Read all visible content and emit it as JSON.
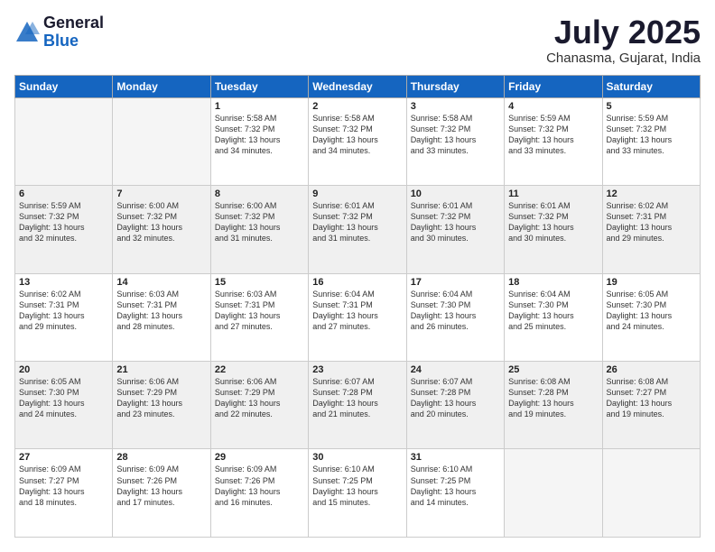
{
  "logo": {
    "general": "General",
    "blue": "Blue"
  },
  "title": "July 2025",
  "location": "Chanasma, Gujarat, India",
  "days_header": [
    "Sunday",
    "Monday",
    "Tuesday",
    "Wednesday",
    "Thursday",
    "Friday",
    "Saturday"
  ],
  "weeks": [
    [
      {
        "day": "",
        "sunrise": "",
        "sunset": "",
        "daylight": ""
      },
      {
        "day": "",
        "sunrise": "",
        "sunset": "",
        "daylight": ""
      },
      {
        "day": "1",
        "sunrise": "Sunrise: 5:58 AM",
        "sunset": "Sunset: 7:32 PM",
        "daylight": "Daylight: 13 hours and 34 minutes."
      },
      {
        "day": "2",
        "sunrise": "Sunrise: 5:58 AM",
        "sunset": "Sunset: 7:32 PM",
        "daylight": "Daylight: 13 hours and 34 minutes."
      },
      {
        "day": "3",
        "sunrise": "Sunrise: 5:58 AM",
        "sunset": "Sunset: 7:32 PM",
        "daylight": "Daylight: 13 hours and 33 minutes."
      },
      {
        "day": "4",
        "sunrise": "Sunrise: 5:59 AM",
        "sunset": "Sunset: 7:32 PM",
        "daylight": "Daylight: 13 hours and 33 minutes."
      },
      {
        "day": "5",
        "sunrise": "Sunrise: 5:59 AM",
        "sunset": "Sunset: 7:32 PM",
        "daylight": "Daylight: 13 hours and 33 minutes."
      }
    ],
    [
      {
        "day": "6",
        "sunrise": "Sunrise: 5:59 AM",
        "sunset": "Sunset: 7:32 PM",
        "daylight": "Daylight: 13 hours and 32 minutes."
      },
      {
        "day": "7",
        "sunrise": "Sunrise: 6:00 AM",
        "sunset": "Sunset: 7:32 PM",
        "daylight": "Daylight: 13 hours and 32 minutes."
      },
      {
        "day": "8",
        "sunrise": "Sunrise: 6:00 AM",
        "sunset": "Sunset: 7:32 PM",
        "daylight": "Daylight: 13 hours and 31 minutes."
      },
      {
        "day": "9",
        "sunrise": "Sunrise: 6:01 AM",
        "sunset": "Sunset: 7:32 PM",
        "daylight": "Daylight: 13 hours and 31 minutes."
      },
      {
        "day": "10",
        "sunrise": "Sunrise: 6:01 AM",
        "sunset": "Sunset: 7:32 PM",
        "daylight": "Daylight: 13 hours and 30 minutes."
      },
      {
        "day": "11",
        "sunrise": "Sunrise: 6:01 AM",
        "sunset": "Sunset: 7:32 PM",
        "daylight": "Daylight: 13 hours and 30 minutes."
      },
      {
        "day": "12",
        "sunrise": "Sunrise: 6:02 AM",
        "sunset": "Sunset: 7:31 PM",
        "daylight": "Daylight: 13 hours and 29 minutes."
      }
    ],
    [
      {
        "day": "13",
        "sunrise": "Sunrise: 6:02 AM",
        "sunset": "Sunset: 7:31 PM",
        "daylight": "Daylight: 13 hours and 29 minutes."
      },
      {
        "day": "14",
        "sunrise": "Sunrise: 6:03 AM",
        "sunset": "Sunset: 7:31 PM",
        "daylight": "Daylight: 13 hours and 28 minutes."
      },
      {
        "day": "15",
        "sunrise": "Sunrise: 6:03 AM",
        "sunset": "Sunset: 7:31 PM",
        "daylight": "Daylight: 13 hours and 27 minutes."
      },
      {
        "day": "16",
        "sunrise": "Sunrise: 6:04 AM",
        "sunset": "Sunset: 7:31 PM",
        "daylight": "Daylight: 13 hours and 27 minutes."
      },
      {
        "day": "17",
        "sunrise": "Sunrise: 6:04 AM",
        "sunset": "Sunset: 7:30 PM",
        "daylight": "Daylight: 13 hours and 26 minutes."
      },
      {
        "day": "18",
        "sunrise": "Sunrise: 6:04 AM",
        "sunset": "Sunset: 7:30 PM",
        "daylight": "Daylight: 13 hours and 25 minutes."
      },
      {
        "day": "19",
        "sunrise": "Sunrise: 6:05 AM",
        "sunset": "Sunset: 7:30 PM",
        "daylight": "Daylight: 13 hours and 24 minutes."
      }
    ],
    [
      {
        "day": "20",
        "sunrise": "Sunrise: 6:05 AM",
        "sunset": "Sunset: 7:30 PM",
        "daylight": "Daylight: 13 hours and 24 minutes."
      },
      {
        "day": "21",
        "sunrise": "Sunrise: 6:06 AM",
        "sunset": "Sunset: 7:29 PM",
        "daylight": "Daylight: 13 hours and 23 minutes."
      },
      {
        "day": "22",
        "sunrise": "Sunrise: 6:06 AM",
        "sunset": "Sunset: 7:29 PM",
        "daylight": "Daylight: 13 hours and 22 minutes."
      },
      {
        "day": "23",
        "sunrise": "Sunrise: 6:07 AM",
        "sunset": "Sunset: 7:28 PM",
        "daylight": "Daylight: 13 hours and 21 minutes."
      },
      {
        "day": "24",
        "sunrise": "Sunrise: 6:07 AM",
        "sunset": "Sunset: 7:28 PM",
        "daylight": "Daylight: 13 hours and 20 minutes."
      },
      {
        "day": "25",
        "sunrise": "Sunrise: 6:08 AM",
        "sunset": "Sunset: 7:28 PM",
        "daylight": "Daylight: 13 hours and 19 minutes."
      },
      {
        "day": "26",
        "sunrise": "Sunrise: 6:08 AM",
        "sunset": "Sunset: 7:27 PM",
        "daylight": "Daylight: 13 hours and 19 minutes."
      }
    ],
    [
      {
        "day": "27",
        "sunrise": "Sunrise: 6:09 AM",
        "sunset": "Sunset: 7:27 PM",
        "daylight": "Daylight: 13 hours and 18 minutes."
      },
      {
        "day": "28",
        "sunrise": "Sunrise: 6:09 AM",
        "sunset": "Sunset: 7:26 PM",
        "daylight": "Daylight: 13 hours and 17 minutes."
      },
      {
        "day": "29",
        "sunrise": "Sunrise: 6:09 AM",
        "sunset": "Sunset: 7:26 PM",
        "daylight": "Daylight: 13 hours and 16 minutes."
      },
      {
        "day": "30",
        "sunrise": "Sunrise: 6:10 AM",
        "sunset": "Sunset: 7:25 PM",
        "daylight": "Daylight: 13 hours and 15 minutes."
      },
      {
        "day": "31",
        "sunrise": "Sunrise: 6:10 AM",
        "sunset": "Sunset: 7:25 PM",
        "daylight": "Daylight: 13 hours and 14 minutes."
      },
      {
        "day": "",
        "sunrise": "",
        "sunset": "",
        "daylight": ""
      },
      {
        "day": "",
        "sunrise": "",
        "sunset": "",
        "daylight": ""
      }
    ]
  ]
}
